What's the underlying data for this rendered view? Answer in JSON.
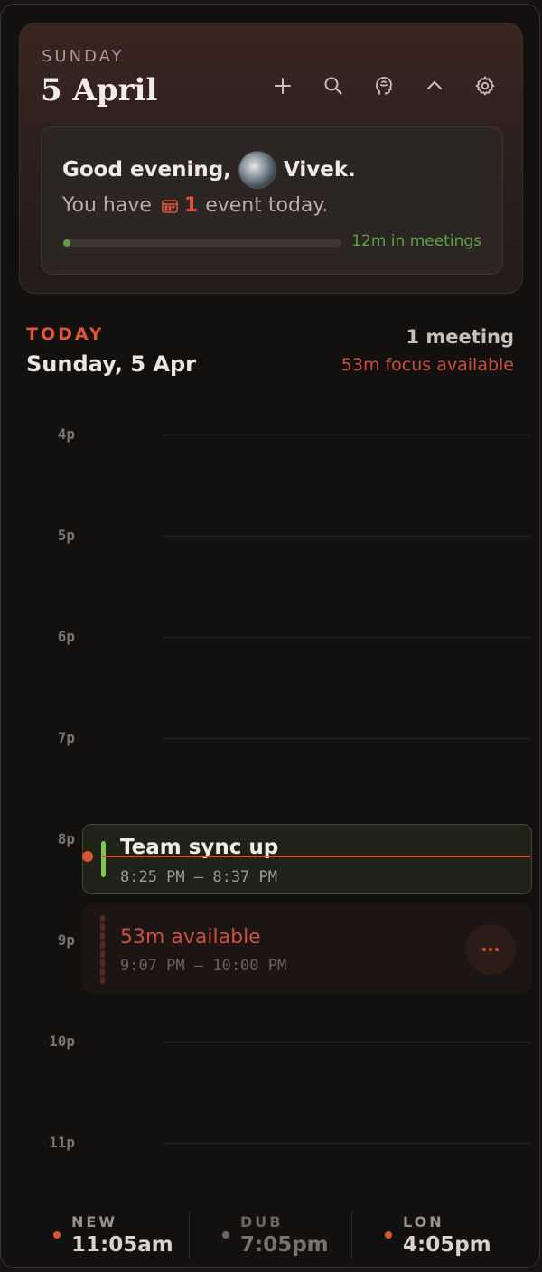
{
  "header": {
    "weekday": "SUNDAY",
    "date": "5 April",
    "toolbar_icons": [
      "plus-icon",
      "search-icon",
      "brain-icon",
      "chevron-up-icon",
      "gear-icon"
    ]
  },
  "greeting": {
    "prefix": "Good evening,",
    "name": "Vivek.",
    "sub_prefix": "You have",
    "event_count": "1",
    "sub_suffix": "event today.",
    "progress_label": "12m in meetings",
    "progress_fraction": 0.02
  },
  "today": {
    "label": "TODAY",
    "date": "Sunday, 5 Apr",
    "meetings": "1 meeting",
    "focus": "53m focus available"
  },
  "timeline": {
    "hours": [
      "4p",
      "5p",
      "6p",
      "7p",
      "8p",
      "9p",
      "10p",
      "11p"
    ]
  },
  "events": [
    {
      "title": "Team sync up",
      "time": "8:25 PM – 8:37 PM",
      "color": "#7cc84e"
    }
  ],
  "available": {
    "title": "53m available",
    "time": "9:07 PM – 10:00 PM"
  },
  "clocks": [
    {
      "city": "NEW",
      "time": "11:05am",
      "dot_color": "#d75536",
      "active": true
    },
    {
      "city": "DUB",
      "time": "7:05pm",
      "dot_color": "#6b6462",
      "active": false
    },
    {
      "city": "LON",
      "time": "4:05pm",
      "dot_color": "#d75536",
      "active": true
    }
  ],
  "colors": {
    "accent": "#e0533d",
    "meeting_green": "#5fa045",
    "background": "#131110"
  }
}
